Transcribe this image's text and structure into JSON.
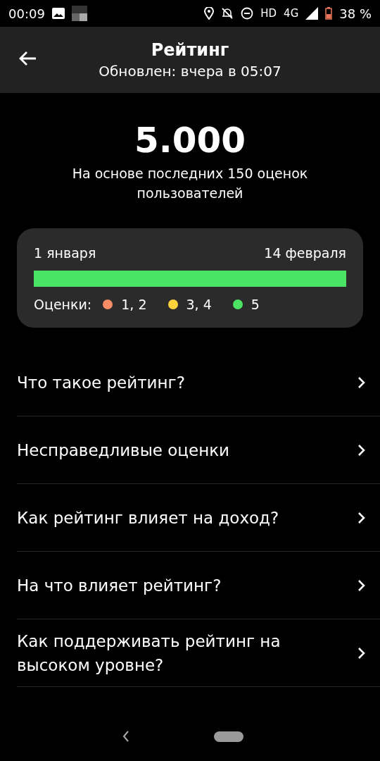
{
  "status_bar": {
    "time": "00:09",
    "network": "HD",
    "generation": "4G",
    "battery": "38 %"
  },
  "header": {
    "title": "Рейтинг",
    "subtitle": "Обновлен: вчера в 05:07"
  },
  "rating": {
    "value": "5.000",
    "caption": "На основе последних 150 оценок пользователей"
  },
  "history": {
    "start": "1 января",
    "end": "14 февраля",
    "segments": [
      {
        "color": "#4ae364",
        "level": 1
      }
    ],
    "legend_label": "Оценки:",
    "legend": [
      {
        "label": "1, 2",
        "color": "#f88c64"
      },
      {
        "label": "3, 4",
        "color": "#fcd23a"
      },
      {
        "label": "5",
        "color": "#4ae364"
      }
    ]
  },
  "menu": [
    "Что такое рейтинг?",
    "Несправедливые оценки",
    "Как рейтинг влияет на доход?",
    "На что влияет рейтинг?",
    "Как поддерживать рейтинг на высоком уровне?"
  ]
}
